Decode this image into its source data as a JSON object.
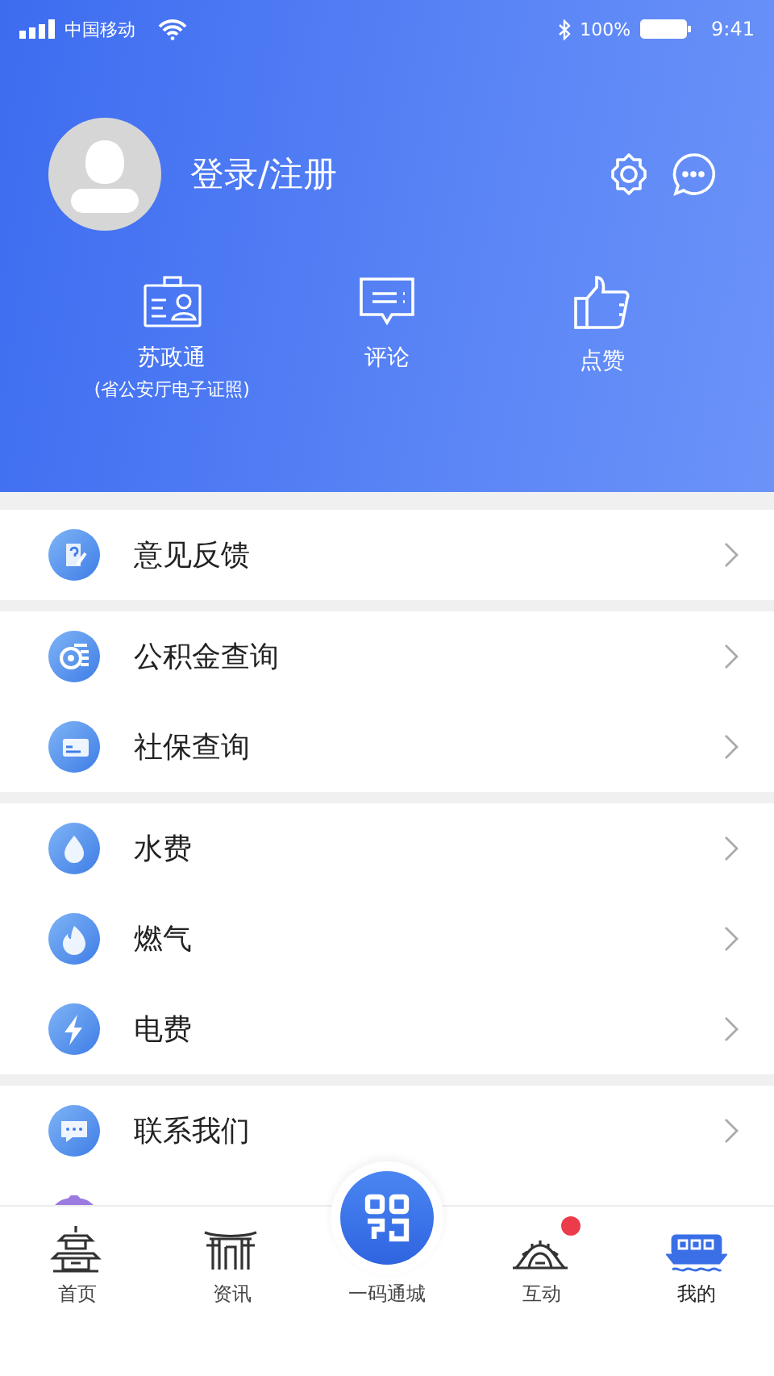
{
  "status_bar": {
    "carrier": "中国移动",
    "battery": "100%",
    "time": "9:41"
  },
  "profile": {
    "login_label": "登录/注册"
  },
  "quick_actions": [
    {
      "kind": "id-card",
      "label": "苏政通",
      "sublabel": "(省公安厅电子证照)"
    },
    {
      "kind": "comment",
      "label": "评论"
    },
    {
      "kind": "thumb",
      "label": "点赞"
    }
  ],
  "menu_groups": [
    {
      "items": [
        {
          "kind": "feedback",
          "label": "意见反馈"
        }
      ]
    },
    {
      "items": [
        {
          "kind": "coins",
          "label": "公积金查询"
        },
        {
          "kind": "card",
          "label": "社保查询"
        }
      ]
    },
    {
      "items": [
        {
          "kind": "water",
          "label": "水费"
        },
        {
          "kind": "fire",
          "label": "燃气"
        },
        {
          "kind": "bolt",
          "label": "电费"
        }
      ]
    },
    {
      "items": [
        {
          "kind": "chat",
          "label": "联系我们"
        },
        {
          "kind": "partial"
        }
      ]
    }
  ],
  "tabs": [
    {
      "kind": "pagoda",
      "label": "首页",
      "selected": false,
      "badge": false
    },
    {
      "kind": "gate",
      "label": "资讯",
      "selected": false,
      "badge": false
    },
    {
      "kind": "qr",
      "label": "一码通城",
      "selected": false,
      "badge": false
    },
    {
      "kind": "bridge",
      "label": "互动",
      "selected": false,
      "badge": true
    },
    {
      "kind": "boat",
      "label": "我的",
      "selected": true,
      "badge": false
    }
  ]
}
